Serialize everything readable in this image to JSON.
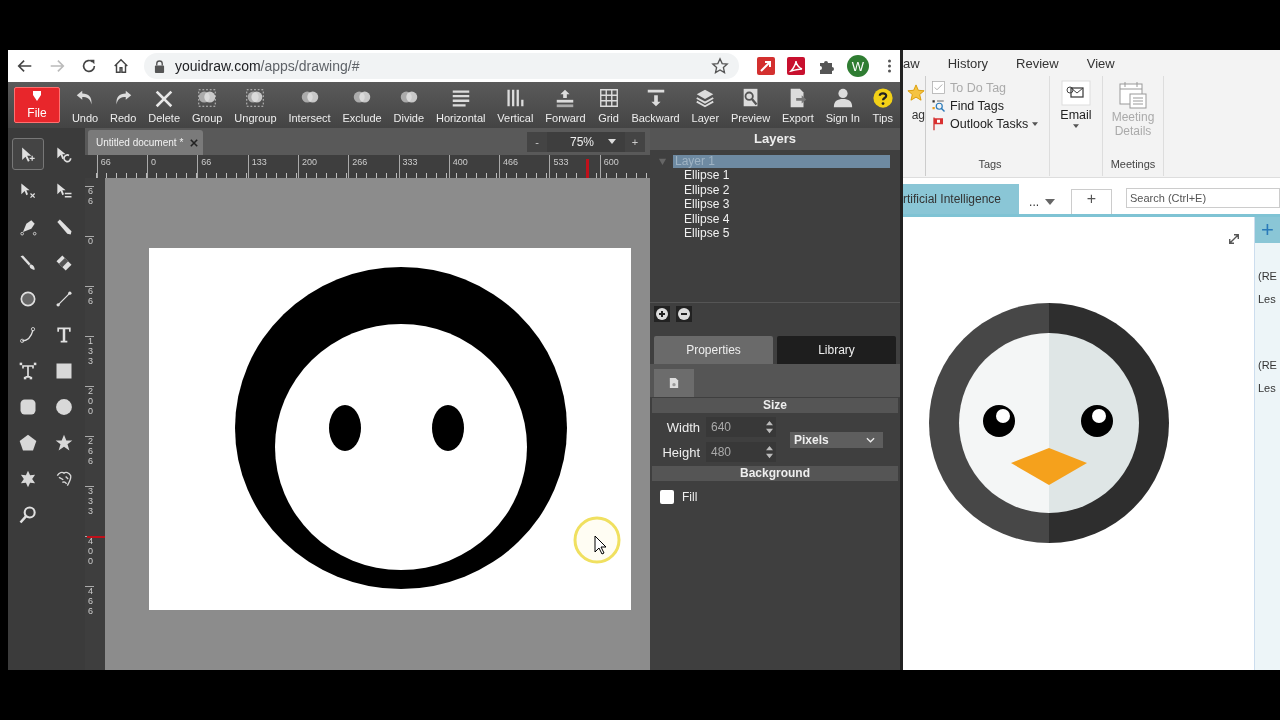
{
  "browser": {
    "url_host": "youidraw.com",
    "url_path": "/apps/drawing/#",
    "forward_disabled": true,
    "profile_initial": "W"
  },
  "toolbar": [
    {
      "kind": "file",
      "label": "File"
    },
    {
      "kind": "undo",
      "label": "Undo"
    },
    {
      "kind": "redo",
      "label": "Redo"
    },
    {
      "kind": "delete",
      "label": "Delete"
    },
    {
      "kind": "group",
      "label": "Group"
    },
    {
      "kind": "ungroup",
      "label": "Ungroup"
    },
    {
      "kind": "intersect",
      "label": "Intersect"
    },
    {
      "kind": "exclude",
      "label": "Exclude"
    },
    {
      "kind": "divide",
      "label": "Divide"
    },
    {
      "kind": "horizontal",
      "label": "Horizontal"
    },
    {
      "kind": "vertical",
      "label": "Vertical"
    },
    {
      "kind": "forward",
      "label": "Forward"
    },
    {
      "kind": "grid",
      "label": "Grid"
    },
    {
      "kind": "backward",
      "label": "Backward"
    },
    {
      "kind": "layer",
      "label": "Layer"
    },
    {
      "kind": "preview",
      "label": "Preview"
    },
    {
      "kind": "export",
      "label": "Export"
    },
    {
      "kind": "signin",
      "label": "Sign In"
    },
    {
      "kind": "tips",
      "label": "Tips"
    }
  ],
  "document_tab": {
    "title": "Untitled document *"
  },
  "zoom": {
    "minus": "-",
    "value": "75%",
    "plus": "+"
  },
  "ruler": {
    "horizontal": [
      "66",
      "0",
      "66",
      "133",
      "200",
      "266",
      "333",
      "400",
      "466",
      "533",
      "600"
    ],
    "vertical": [
      "66",
      "0",
      "66",
      "133",
      "200",
      "266",
      "333",
      "400",
      "466"
    ]
  },
  "tools": [
    {
      "kind": "select",
      "selected": true
    },
    {
      "kind": "rotate",
      "selected": false
    },
    {
      "kind": "direct",
      "selected": false
    },
    {
      "kind": "swap",
      "selected": false
    },
    {
      "kind": "pen",
      "selected": false
    },
    {
      "kind": "pencil",
      "selected": false
    },
    {
      "kind": "brush",
      "selected": false
    },
    {
      "kind": "eraser",
      "selected": false
    },
    {
      "kind": "ellipse",
      "selected": false
    },
    {
      "kind": "line",
      "selected": false
    },
    {
      "kind": "curve",
      "selected": false
    },
    {
      "kind": "text",
      "selected": false
    },
    {
      "kind": "textbox",
      "selected": false
    },
    {
      "kind": "rect",
      "selected": false
    },
    {
      "kind": "rounded",
      "selected": false
    },
    {
      "kind": "circle",
      "selected": false
    },
    {
      "kind": "pentagon",
      "selected": false
    },
    {
      "kind": "star",
      "selected": false
    },
    {
      "kind": "burst",
      "selected": false
    },
    {
      "kind": "freehand",
      "selected": false
    },
    {
      "kind": "zoom",
      "selected": false
    }
  ],
  "layers": {
    "title": "Layers",
    "items": [
      {
        "name": "Layer 1",
        "selected": true,
        "expanded": true,
        "children": [
          {
            "name": "Ellipse 1",
            "selected": false
          },
          {
            "name": "Ellipse 2",
            "selected": false
          },
          {
            "name": "Ellipse 3",
            "selected": false
          },
          {
            "name": "Ellipse 4",
            "selected": false
          },
          {
            "name": "Ellipse 5",
            "selected": false
          }
        ]
      }
    ]
  },
  "panel_tabs": [
    {
      "label": "Properties",
      "selected": true
    },
    {
      "label": "Library",
      "selected": false
    }
  ],
  "size": {
    "title": "Size",
    "fields": [
      {
        "label": "Width",
        "value": "640"
      },
      {
        "label": "Height",
        "value": "480"
      }
    ],
    "unit": "Pixels"
  },
  "background": {
    "title": "Background",
    "fill_label": "Fill",
    "checked": false
  },
  "onenote": {
    "ribbon_tabs": [
      "aw",
      "History",
      "Review",
      "View"
    ],
    "partial_label": "ag",
    "tags": [
      {
        "kind": "todo",
        "label": "To Do Tag",
        "disabled": true,
        "dropdown": false
      },
      {
        "kind": "find",
        "label": "Find Tags",
        "disabled": false,
        "dropdown": false
      },
      {
        "kind": "outlook",
        "label": "Outlook Tasks",
        "disabled": false,
        "dropdown": true
      }
    ],
    "tags_group": "Tags",
    "email": "Email",
    "meeting": "Meeting Details",
    "meeting_disabled": true,
    "meetings_group": "Meetings",
    "section_tab": "rtificial Intelligence",
    "more": "...",
    "add_tab": "+",
    "search_placeholder": "Search (Ctrl+E)",
    "page_list_add": "+",
    "page_list": [
      "(RE",
      "Les",
      "(RE",
      "Les"
    ]
  }
}
